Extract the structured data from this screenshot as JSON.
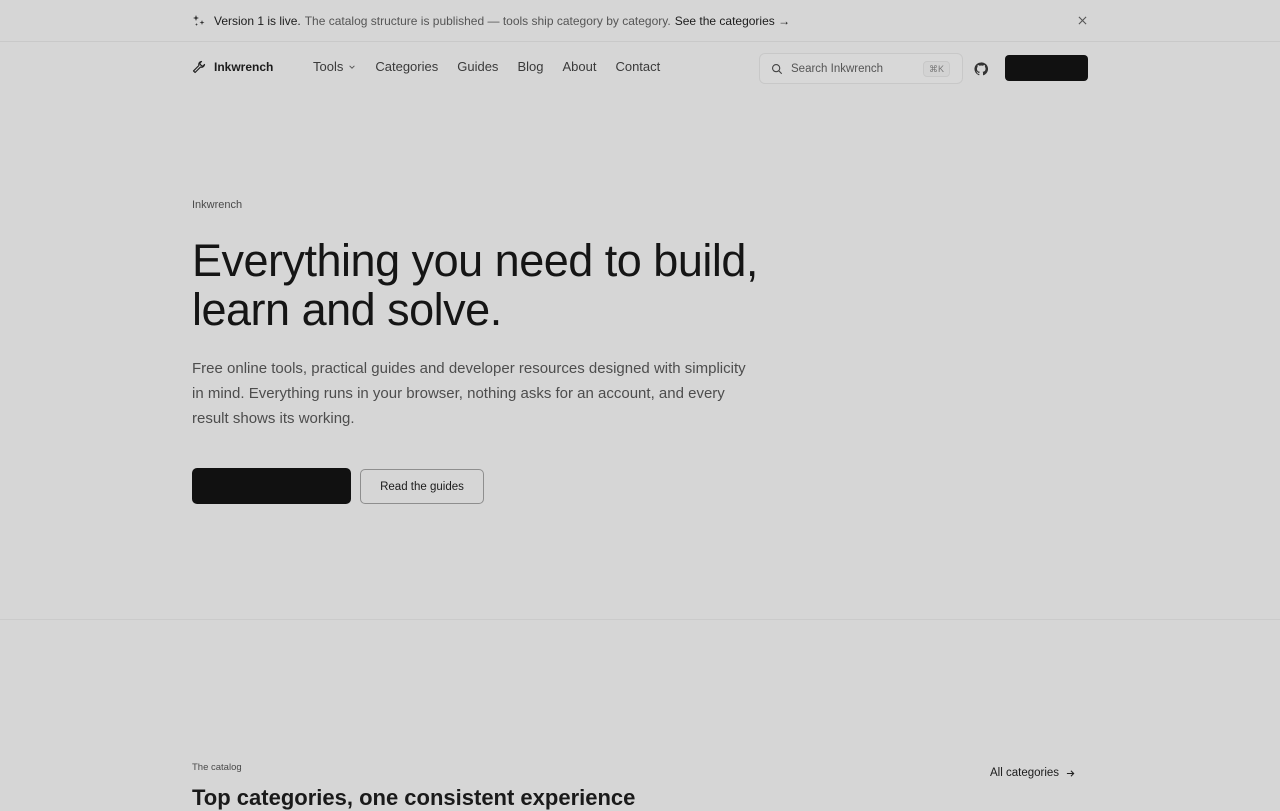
{
  "announcement": {
    "strong": "Version 1 is live.",
    "text": "The catalog structure is published — tools ship category by category.",
    "link": "See the categories →"
  },
  "nav": {
    "brand": "Inkwrench",
    "items": [
      {
        "label": "Tools",
        "dropdown": true
      },
      {
        "label": "Categories"
      },
      {
        "label": "Guides"
      },
      {
        "label": "Blog"
      },
      {
        "label": "About"
      },
      {
        "label": "Contact"
      }
    ],
    "search_placeholder": "Search Inkwrench",
    "search_shortcut": "⌘K"
  },
  "hero": {
    "eyebrow": "Inkwrench",
    "headline": "Everything you need to build, learn and solve.",
    "lead": "Free online tools, practical guides and developer resources designed with simplicity in mind. Everything runs in your browser, nothing asks for an account, and every result shows its working.",
    "secondary_button": "Read the guides"
  },
  "catalog": {
    "eyebrow": "The catalog",
    "title": "Top categories, one consistent experience",
    "all_link": "All categories"
  },
  "colors": {
    "background": "#d6d6d6",
    "primary_button": "#111111"
  }
}
